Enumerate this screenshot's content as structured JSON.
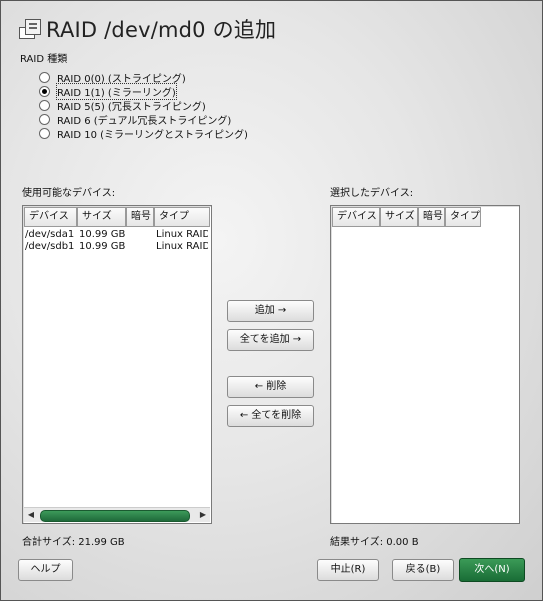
{
  "title": "RAID /dev/md0 の追加",
  "raid_type_label": "RAID 種類",
  "raid_options": [
    {
      "label": "RAID 0(0)  (ストライピング)",
      "selected": false
    },
    {
      "label": "RAID 1(1)  (ミラーリング)",
      "selected": true
    },
    {
      "label": "RAID 5(5)  (冗長ストライピング)",
      "selected": false
    },
    {
      "label": "RAID 6 (デュアル冗長ストライピング)",
      "selected": false
    },
    {
      "label": "RAID 10  (ミラーリングとストライピング)",
      "selected": false
    }
  ],
  "available": {
    "label": "使用可能なデバイス:",
    "columns": [
      "デバイス",
      "サイズ",
      "暗号",
      "タイプ"
    ],
    "rows": [
      {
        "device": "/dev/sda1",
        "size": "10.99 GB",
        "enc": "",
        "type": "Linux RAID"
      },
      {
        "device": "/dev/sdb1",
        "size": "10.99 GB",
        "enc": "",
        "type": "Linux RAID"
      }
    ],
    "total_label": "合計サイズ: 21.99 GB"
  },
  "selected": {
    "label": "選択したデバイス:",
    "columns": [
      "デバイス",
      "サイズ",
      "暗号",
      "タイプ"
    ],
    "total_label": "結果サイズ: 0.00 B"
  },
  "buttons": {
    "add": "追加 →",
    "add_all": "全てを追加 →",
    "remove": "← 削除",
    "remove_all": "← 全てを削除",
    "help": "ヘルプ",
    "abort": "中止(R)",
    "back": "戻る(B)",
    "next": "次へ(N)"
  }
}
